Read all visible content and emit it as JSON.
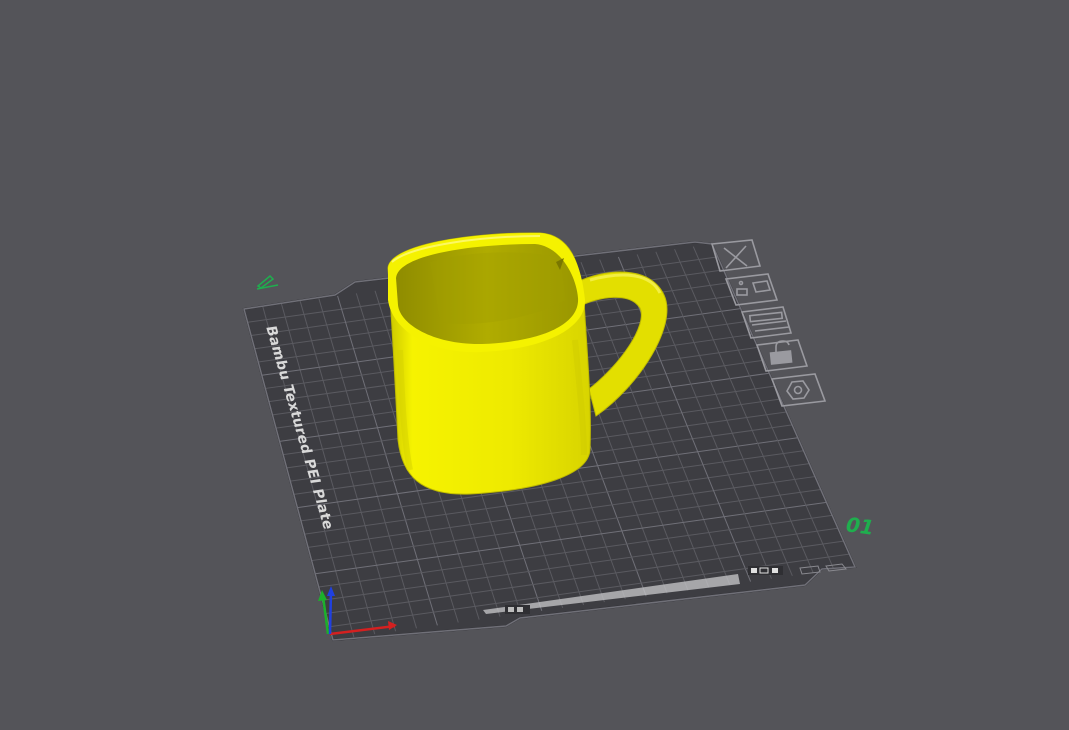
{
  "plate": {
    "label": "Bambu Textured PEI Plate",
    "number": "01",
    "number_color": "#1fae4e",
    "surface_color": "#3d3d42",
    "grid_color": "#5a5a60",
    "background": "#545459"
  },
  "model": {
    "name": "mug",
    "color": "#f2ee00",
    "shade_color": "#b6b200"
  },
  "plate_toolbar": [
    {
      "icon": "close-icon",
      "action": "delete plate"
    },
    {
      "icon": "arrange-icon",
      "action": "arrange"
    },
    {
      "icon": "orient-icon",
      "action": "auto orient"
    },
    {
      "icon": "lock-icon",
      "action": "lock plate"
    },
    {
      "icon": "settings-icon",
      "action": "plate settings"
    }
  ],
  "axes": {
    "x_color": "#d42020",
    "y_color": "#1bb02b",
    "z_color": "#2040e0"
  }
}
